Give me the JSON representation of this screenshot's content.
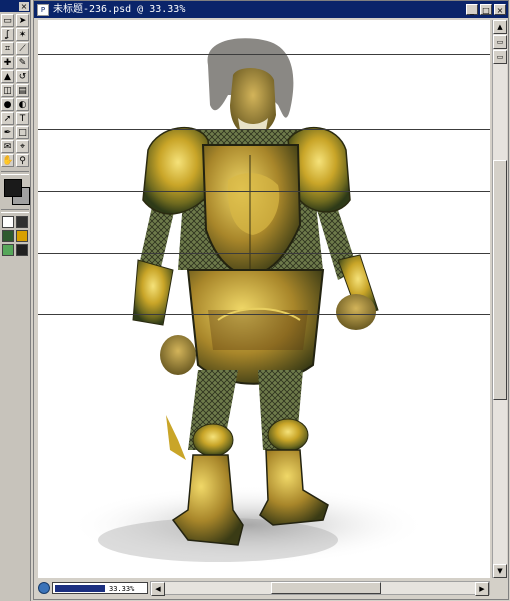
{
  "document": {
    "title": "未标题-236.psd @ 33.33%",
    "zoom": "33.33%",
    "scroll_vertical_fraction": 0.32,
    "scroll_horizontal_fraction": 0.34
  },
  "toolbox": {
    "close_glyph": "×",
    "tools": [
      {
        "name": "marquee-tool",
        "glyph": "▭"
      },
      {
        "name": "move-tool",
        "glyph": "➤"
      },
      {
        "name": "lasso-tool",
        "glyph": "ʆ"
      },
      {
        "name": "magic-wand-tool",
        "glyph": "✶"
      },
      {
        "name": "crop-tool",
        "glyph": "⌗"
      },
      {
        "name": "slice-tool",
        "glyph": "⟋"
      },
      {
        "name": "healing-tool",
        "glyph": "✚"
      },
      {
        "name": "brush-tool",
        "glyph": "✎"
      },
      {
        "name": "stamp-tool",
        "glyph": "▲"
      },
      {
        "name": "history-brush-tool",
        "glyph": "↺"
      },
      {
        "name": "eraser-tool",
        "glyph": "◫"
      },
      {
        "name": "gradient-tool",
        "glyph": "▤"
      },
      {
        "name": "blur-tool",
        "glyph": "●"
      },
      {
        "name": "dodge-tool",
        "glyph": "◐"
      },
      {
        "name": "path-select-tool",
        "glyph": "➚"
      },
      {
        "name": "type-tool",
        "glyph": "T"
      },
      {
        "name": "pen-tool",
        "glyph": "✒"
      },
      {
        "name": "shape-tool",
        "glyph": "□"
      },
      {
        "name": "notes-tool",
        "glyph": "✉"
      },
      {
        "name": "eyedropper-tool",
        "glyph": "⌖"
      },
      {
        "name": "hand-tool",
        "glyph": "✋"
      },
      {
        "name": "zoom-tool",
        "glyph": "⚲"
      }
    ]
  },
  "colors": {
    "foreground": "#1a1a1a",
    "background": "#a0a0a0",
    "titlebar": "#0a246a",
    "guides": "#3c3c3c"
  },
  "window_buttons": {
    "minimize": "_",
    "maximize": "□",
    "close": "×"
  }
}
